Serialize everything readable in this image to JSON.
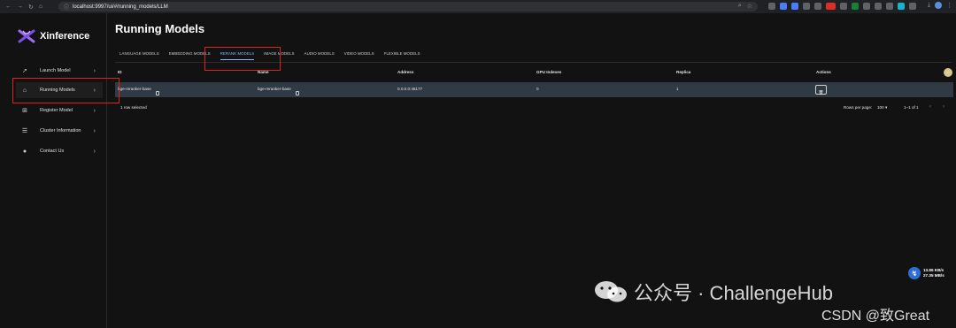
{
  "browser": {
    "url": "localhost:9997/ui/#/running_models/LLM"
  },
  "sidebar": {
    "brand": "Xinference",
    "items": [
      {
        "label": "Launch Model",
        "icon": "rocket-icon"
      },
      {
        "label": "Running Models",
        "icon": "running-models-icon"
      },
      {
        "label": "Register Model",
        "icon": "register-icon"
      },
      {
        "label": "Cluster Information",
        "icon": "cluster-icon"
      },
      {
        "label": "Contact Us",
        "icon": "github-icon"
      }
    ]
  },
  "main": {
    "title": "Running Models",
    "tabs": [
      {
        "label": "LANGUAGE MODELS",
        "active": false
      },
      {
        "label": "EMBEDDING MODELS",
        "active": false
      },
      {
        "label": "RERANK MODELS",
        "active": true
      },
      {
        "label": "IMAGE MODELS",
        "active": false
      },
      {
        "label": "AUDIO MODELS",
        "active": false
      },
      {
        "label": "VIDEO MODELS",
        "active": false
      },
      {
        "label": "FLEXIBLE MODELS",
        "active": false
      }
    ],
    "table": {
      "columns": [
        "ID",
        "Name",
        "Address",
        "GPU Indexes",
        "Replica",
        "Actions"
      ],
      "rows": [
        {
          "id": "bge-reranker-base",
          "name": "bge-reranker-base",
          "address": "0.0.0.0:46177",
          "gpu_indexes": "0",
          "replica": "1"
        }
      ],
      "selected_text": "1 row selected",
      "rows_per_page_label": "Rows per page:",
      "rows_per_page_value": "100",
      "range_text": "1–1 of 1"
    }
  },
  "network": {
    "upload": "13.86 KB/s",
    "download": "27.35 MB/s"
  },
  "watermark": {
    "line1": "公众号 · ChallengeHub",
    "line2": "CSDN @致Great"
  },
  "colors": {
    "background": "#121212",
    "row_selected": "#2f3a45",
    "tab_active": "#8fb6ff",
    "highlight": "#dd2222"
  }
}
